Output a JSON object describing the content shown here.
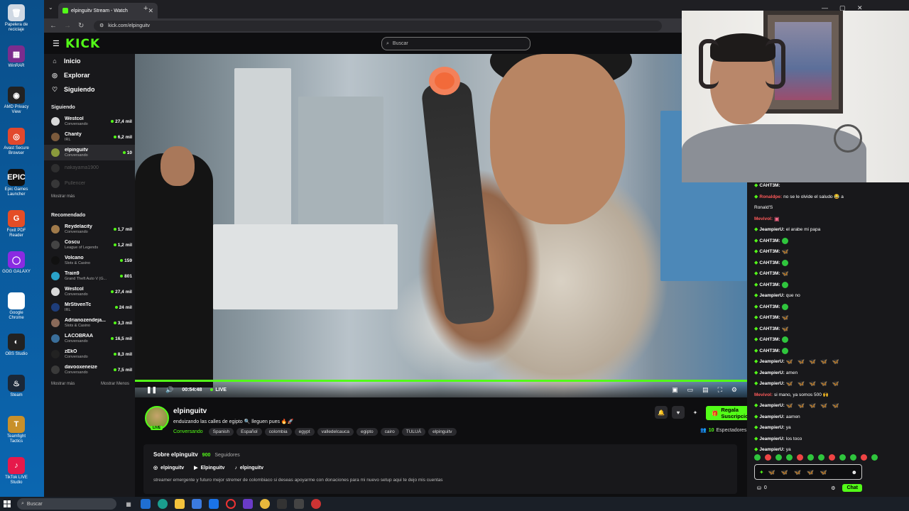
{
  "desktop": {
    "icons": [
      {
        "label": "Papelera de reciclaje",
        "color": "#cfd8e3",
        "glyph": "🗑"
      },
      {
        "label": "WinRAR",
        "color": "#7b2d8e",
        "glyph": "▦"
      },
      {
        "label": "AMD Privacy View",
        "color": "#222",
        "glyph": "◉"
      },
      {
        "label": "Avast Secure Browser",
        "color": "#e2482d",
        "glyph": "◎"
      },
      {
        "label": "Epic Games Launcher",
        "color": "#111",
        "glyph": "EPIC"
      },
      {
        "label": "Foxit PDF Reader",
        "color": "#e44d26",
        "glyph": "G"
      },
      {
        "label": "GOG GALAXY",
        "color": "#8a2be2",
        "glyph": "◯"
      },
      {
        "label": "Google Chrome",
        "color": "#fff",
        "glyph": "◉"
      },
      {
        "label": "OBS Studio",
        "color": "#222",
        "glyph": "◐"
      },
      {
        "label": "Steam",
        "color": "#1b2838",
        "glyph": "♨"
      },
      {
        "label": "Teamfight Tactics",
        "color": "#c8902a",
        "glyph": "T"
      },
      {
        "label": "TikTok LIVE Studio",
        "color": "#e6194b",
        "glyph": "♪"
      }
    ]
  },
  "browser": {
    "tab_title": "elpinguitv Stream - Watch",
    "url": "kick.com/elpinguitv"
  },
  "kick": {
    "logo": "KICK",
    "search_placeholder": "Buscar",
    "nav": [
      {
        "icon": "⌂",
        "label": "Inicio"
      },
      {
        "icon": "◎",
        "label": "Explorar"
      },
      {
        "icon": "♡",
        "label": "Siguiendo"
      }
    ],
    "following_header": "Siguiendo",
    "following": [
      {
        "name": "Westcol",
        "category": "Conversando",
        "viewers": "27,4 mil",
        "color": "#d8d8d8",
        "active": false,
        "online": true
      },
      {
        "name": "Chanty",
        "category": "IRL",
        "viewers": "6,2 mil",
        "color": "#7b5a3c",
        "active": false,
        "online": true
      },
      {
        "name": "elpinguitv",
        "category": "Conversando",
        "viewers": "10",
        "color": "#8a9a3c",
        "active": true,
        "online": true
      },
      {
        "name": "nakayama1900",
        "category": "",
        "viewers": "",
        "color": "#444",
        "active": false,
        "online": false
      },
      {
        "name": "Pullencer",
        "category": "",
        "viewers": "",
        "color": "#555",
        "active": false,
        "online": false
      }
    ],
    "show_more": "Mostrar más",
    "recommended_header": "Recomendado",
    "recommended": [
      {
        "name": "Reydelacity",
        "category": "Conversando",
        "viewers": "1,7 mil",
        "color": "#a07a4a"
      },
      {
        "name": "Coscu",
        "category": "League of Legends",
        "viewers": "1,2 mil",
        "color": "#444"
      },
      {
        "name": "Volcano",
        "category": "Slots & Casino",
        "viewers": "159",
        "color": "#111"
      },
      {
        "name": "Train9",
        "category": "Grand Theft Auto V (G...",
        "viewers": "801",
        "color": "#2aa2c8"
      },
      {
        "name": "Westcol",
        "category": "Conversando",
        "viewers": "27,4 mil",
        "color": "#d8d8d8"
      },
      {
        "name": "MrStivenTc",
        "category": "IRL",
        "viewers": "24 mil",
        "color": "#1e3d7a"
      },
      {
        "name": "Adrianozendeja...",
        "category": "Slots & Casino",
        "viewers": "3,3 mil",
        "color": "#8a6a5a"
      },
      {
        "name": "LACOBRAA",
        "category": "Conversando",
        "viewers": "16,5 mil",
        "color": "#3a6e9a"
      },
      {
        "name": "zEkO",
        "category": "Conversando",
        "viewers": "8,3 mil",
        "color": "#222"
      },
      {
        "name": "davooxeneize",
        "category": "Conversando",
        "viewers": "7,5 mil",
        "color": "#3a3a3a"
      }
    ],
    "show_more_2": "Mostrar más",
    "show_less": "Mostrar Menos"
  },
  "player": {
    "elapsed": "00:54:48",
    "live_label": "LIVE",
    "progress": 1.0
  },
  "stream": {
    "channel": "elpinguitv",
    "live_badge": "LIVE",
    "title": "enduizando las calles de egipto 🔍 lleguen pues 🔥🚀",
    "category": "Conversando",
    "tags": [
      "Spanish",
      "Español",
      "colombia",
      "egypt",
      "valledelcauca",
      "egipto",
      "cairo",
      "TULUÁ",
      "elpinguitv"
    ],
    "subscribe_label": "Regala Suscripciones",
    "viewer_count": "10",
    "viewer_label": "Espectadores",
    "about_title": "Sobre elpinguitv",
    "followers_count": "900",
    "followers_label": "Seguidores",
    "socials": [
      {
        "icon": "◎",
        "label": "elpinguitv"
      },
      {
        "icon": "▶",
        "label": "Elpinguitv"
      },
      {
        "icon": "♪",
        "label": "elpinguitv"
      }
    ],
    "bio": "streamer emergente y futuro mejor stremer de colombiaco si deseas apoyarme con donaciones para mi nuevo setup aqui te dejo mis cuentas"
  },
  "chat": {
    "messages": [
      {
        "user": "CAHT3M:",
        "text": "",
        "emote": "",
        "color": "#fff",
        "badge": true
      },
      {
        "user": "Ronaldpe:",
        "text": "no se le olvide el saludo 😂 a",
        "emote": "",
        "color": "#ff5a5a",
        "badge": true
      },
      {
        "user": "",
        "text": "Ronald'S",
        "emote": "",
        "color": "#fff",
        "badge": false
      },
      {
        "user": "Mevivol:",
        "text": "",
        "emote": "▣",
        "color": "#ff5a5a",
        "badge": false
      },
      {
        "user": "JeampierU:",
        "text": "el arabe mi papa",
        "emote": "",
        "color": "#fff",
        "badge": true
      },
      {
        "user": "CAHT3M:",
        "text": "",
        "emote": "green",
        "color": "#fff",
        "badge": true
      },
      {
        "user": "CAHT3M:",
        "text": "",
        "emote": "🦋",
        "color": "#fff",
        "badge": true
      },
      {
        "user": "CAHT3M:",
        "text": "",
        "emote": "green",
        "color": "#fff",
        "badge": true
      },
      {
        "user": "CAHT3M:",
        "text": "",
        "emote": "🦋",
        "color": "#fff",
        "badge": true
      },
      {
        "user": "CAHT3M:",
        "text": "",
        "emote": "green",
        "color": "#fff",
        "badge": true
      },
      {
        "user": "JeampierU:",
        "text": "que no",
        "emote": "",
        "color": "#fff",
        "badge": true
      },
      {
        "user": "CAHT3M:",
        "text": "",
        "emote": "green",
        "color": "#fff",
        "badge": true
      },
      {
        "user": "CAHT3M:",
        "text": "",
        "emote": "🦋",
        "color": "#fff",
        "badge": true
      },
      {
        "user": "CAHT3M:",
        "text": "",
        "emote": "🦋",
        "color": "#fff",
        "badge": true
      },
      {
        "user": "CAHT3M:",
        "text": "",
        "emote": "green",
        "color": "#fff",
        "badge": true
      },
      {
        "user": "CAHT3M:",
        "text": "",
        "emote": "green",
        "color": "#fff",
        "badge": true
      },
      {
        "user": "JeampierU:",
        "text": "",
        "emote": "🦋 🦋 🦋 🦋 🦋",
        "color": "#fff",
        "badge": true
      },
      {
        "user": "JeampierU:",
        "text": "amen",
        "emote": "",
        "color": "#fff",
        "badge": true
      },
      {
        "user": "JeampierU:",
        "text": "",
        "emote": "🦋 🦋 🦋 🦋 🦋",
        "color": "#fff",
        "badge": true
      },
      {
        "user": "Mevivol:",
        "text": "si mano, ya somos 500 🙌",
        "emote": "",
        "color": "#ff5a5a",
        "badge": false
      },
      {
        "user": "JeampierU:",
        "text": "",
        "emote": "🦋 🦋 🦋 🦋 🦋",
        "color": "#fff",
        "badge": true
      },
      {
        "user": "JeampierU:",
        "text": "aamen",
        "emote": "",
        "color": "#fff",
        "badge": true
      },
      {
        "user": "JeampierU:",
        "text": "ya",
        "emote": "",
        "color": "#fff",
        "badge": true
      },
      {
        "user": "JeampierU:",
        "text": "los toco",
        "emote": "",
        "color": "#fff",
        "badge": true
      },
      {
        "user": "JeampierU:",
        "text": "ya",
        "emote": "",
        "color": "#fff",
        "badge": true
      }
    ],
    "input_value": "🦋 🦋 🦋 🦋 🦋",
    "points": "0",
    "send_label": "Chat"
  },
  "taskbar": {
    "search_placeholder": "Buscar"
  }
}
